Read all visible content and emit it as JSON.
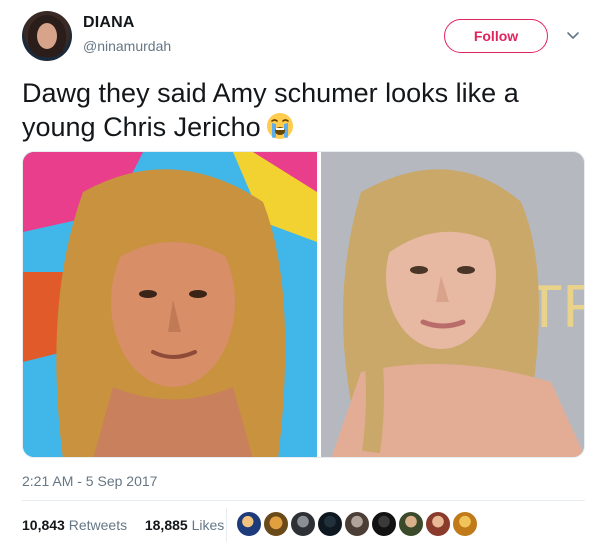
{
  "author": {
    "display_name": "DIANA",
    "handle": "@ninamurdah"
  },
  "follow_label": "Follow",
  "tweet_text": "Dawg they said Amy schumer looks like a young Chris Jericho",
  "emoji": "loudly-crying-face",
  "timestamp": "2:21 AM - 5 Sep 2017",
  "stats": {
    "retweets_count": "10,843",
    "retweets_label": "Retweets",
    "likes_count": "18,885",
    "likes_label": "Likes"
  },
  "colors": {
    "brand_pink": "#e0245e",
    "secondary_text": "#657786",
    "primary_text": "#14171a"
  },
  "liker_avatars": [
    "avatar-1",
    "avatar-2",
    "avatar-3",
    "avatar-4",
    "avatar-5",
    "avatar-6",
    "avatar-7",
    "avatar-8",
    "avatar-9",
    "avatar-10"
  ]
}
